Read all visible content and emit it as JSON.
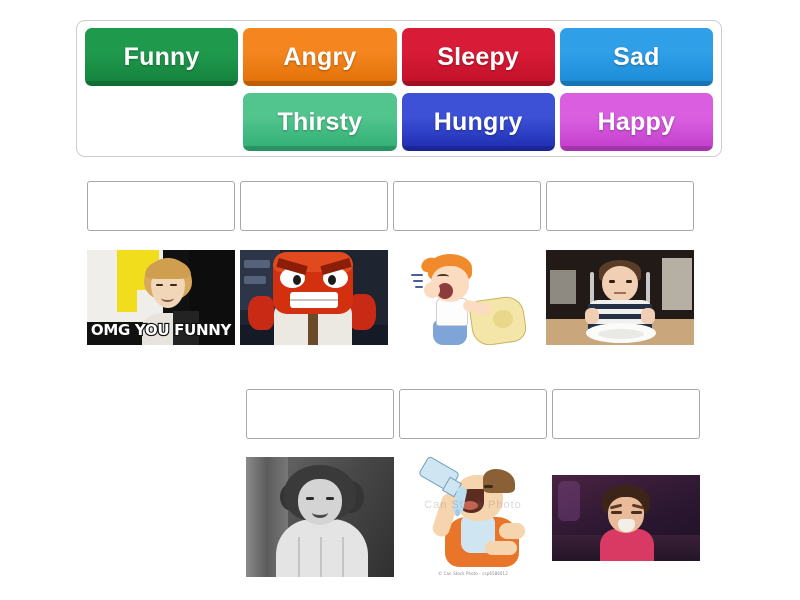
{
  "word_bank": {
    "rows": [
      [
        {
          "label": "Funny",
          "color": "#1f9a4d",
          "color_dark": "#14803c",
          "type": "tile"
        },
        {
          "label": "Angry",
          "color": "#f5861f",
          "color_dark": "#e06f05",
          "type": "tile"
        },
        {
          "label": "Sleepy",
          "color": "#d81b36",
          "color_dark": "#c01028",
          "type": "tile"
        },
        {
          "label": "Sad",
          "color": "#2f9fe8",
          "color_dark": "#1a8ad6",
          "type": "tile"
        }
      ],
      [
        {
          "label": "",
          "color": "",
          "color_dark": "",
          "type": "spacer"
        },
        {
          "label": "Thirsty",
          "color": "#52c48e",
          "color_dark": "#2fae74",
          "type": "tile"
        },
        {
          "label": "Hungry",
          "color": "#3c51d6",
          "color_dark": "#1d2bb0",
          "type": "tile"
        },
        {
          "label": "Happy",
          "color": "#d95fe0",
          "color_dark": "#c23dcb",
          "type": "tile"
        }
      ]
    ]
  },
  "answer_rows": [
    {
      "items": [
        {
          "drop_zone": true,
          "drop_value": "",
          "image_name": "omg-you-funny-meme",
          "image_caption": "OMG YOU FUNNY"
        },
        {
          "drop_zone": true,
          "drop_value": "",
          "image_name": "angry-cartoon-character",
          "image_caption": ""
        },
        {
          "drop_zone": true,
          "drop_value": "",
          "image_name": "yawning-boy-with-pillow",
          "image_caption": ""
        },
        {
          "drop_zone": true,
          "drop_value": "",
          "image_name": "boy-with-empty-plate",
          "image_caption": ""
        }
      ]
    },
    {
      "items": [
        {
          "drop_zone": true,
          "drop_value": "",
          "image_name": "smiling-girl-black-and-white",
          "image_caption": ""
        },
        {
          "drop_zone": true,
          "drop_value": "",
          "image_name": "man-drinking-water-cartoon",
          "image_caption": "",
          "watermark": "Can Stock Photo",
          "credit": "© Can Stock Photo - csp6586012"
        },
        {
          "drop_zone": true,
          "drop_value": "",
          "image_name": "crying-child",
          "image_caption": ""
        }
      ]
    }
  ],
  "colors": {
    "page_background": "#ffffff",
    "panel_border": "#cdcdcd",
    "dropzone_border": "#a8a8a8",
    "tile_text": "#ffffff"
  }
}
